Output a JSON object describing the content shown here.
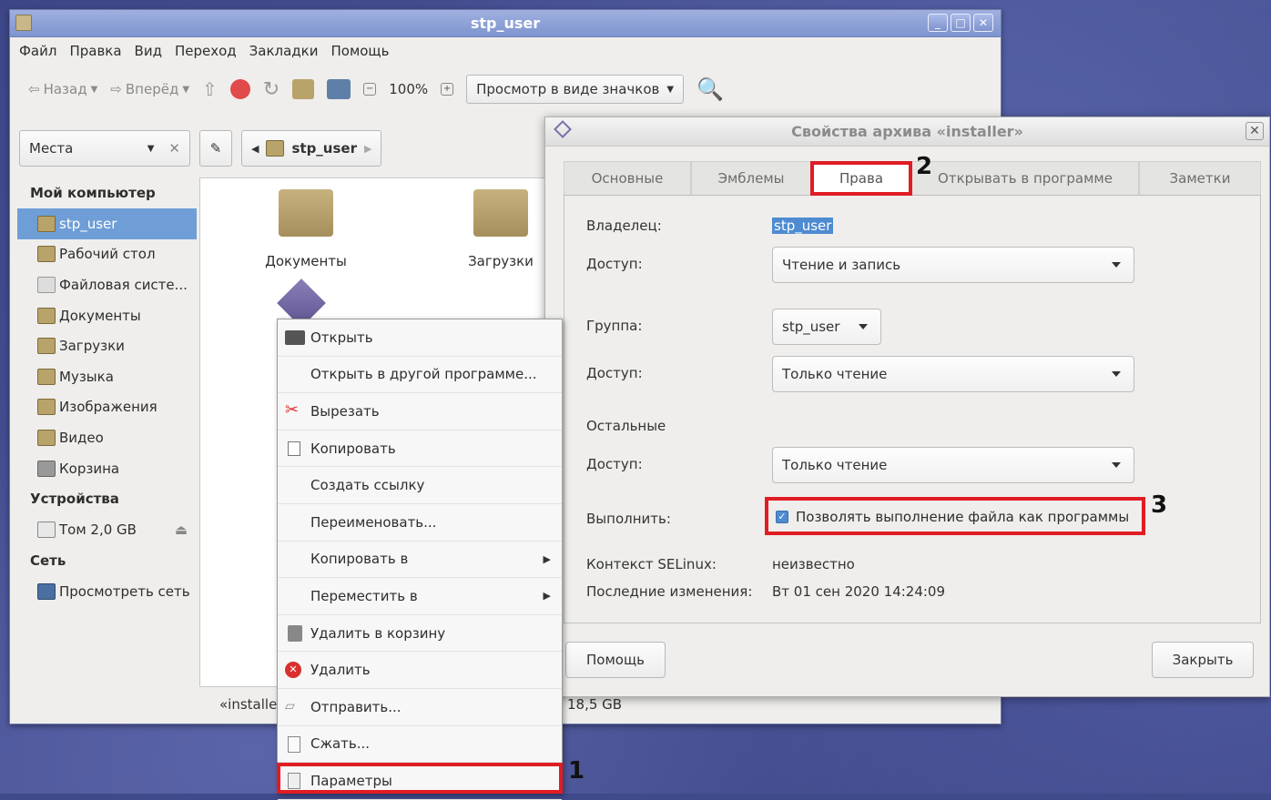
{
  "fm": {
    "title": "stp_user",
    "menu": [
      "Файл",
      "Правка",
      "Вид",
      "Переход",
      "Закладки",
      "Помощь"
    ],
    "toolbar": {
      "back": "Назад",
      "forward": "Вперёд",
      "zoom": "100%",
      "view_mode": "Просмотр в виде значков"
    },
    "places_label": "Места",
    "path_crumb": "stp_user",
    "sidebar": {
      "section_computer": "Мой компьютер",
      "items": [
        "stp_user",
        "Рабочий стол",
        "Файловая систе...",
        "Документы",
        "Загрузки",
        "Музыка",
        "Изображения",
        "Видео",
        "Корзина"
      ],
      "section_devices": "Устройства",
      "device": "Том 2,0 GB",
      "section_network": "Сеть",
      "network_item": "Просмотреть сеть"
    },
    "files": [
      "Документы",
      "Загрузки"
    ],
    "status_left": "«installer",
    "status_right": "18,5 GB"
  },
  "context_menu": {
    "items": [
      "Открыть",
      "Открыть в другой программе...",
      "Вырезать",
      "Копировать",
      "Создать ссылку",
      "Переименовать...",
      "Копировать в",
      "Переместить в",
      "Удалить в корзину",
      "Удалить",
      "Отправить...",
      "Сжать...",
      "Параметры"
    ]
  },
  "dialog": {
    "title": "Свойства архива «installer»",
    "tabs": [
      "Основные",
      "Эмблемы",
      "Права",
      "Открывать в программе",
      "Заметки"
    ],
    "owner_label": "Владелец:",
    "owner_value": "stp_user",
    "access_label": "Доступ:",
    "owner_access": "Чтение и запись",
    "group_label": "Группа:",
    "group_value": "stp_user",
    "group_access": "Только чтение",
    "others_label": "Остальные",
    "others_access": "Только чтение",
    "execute_label": "Выполнить:",
    "execute_checkbox": "Позволять выполнение файла как программы",
    "selinux_label": "Контекст SELinux:",
    "selinux_value": "неизвестно",
    "modified_label": "Последние изменения:",
    "modified_value": "Вт 01 сен 2020 14:24:09",
    "help_button": "Помощь",
    "close_button": "Закрыть"
  },
  "annotations": {
    "step1": "1",
    "step2": "2",
    "step3": "3"
  },
  "colors": {
    "highlight": "#e01c24",
    "selection": "#6f9ed6",
    "titlebar": "#8a9ed6"
  }
}
